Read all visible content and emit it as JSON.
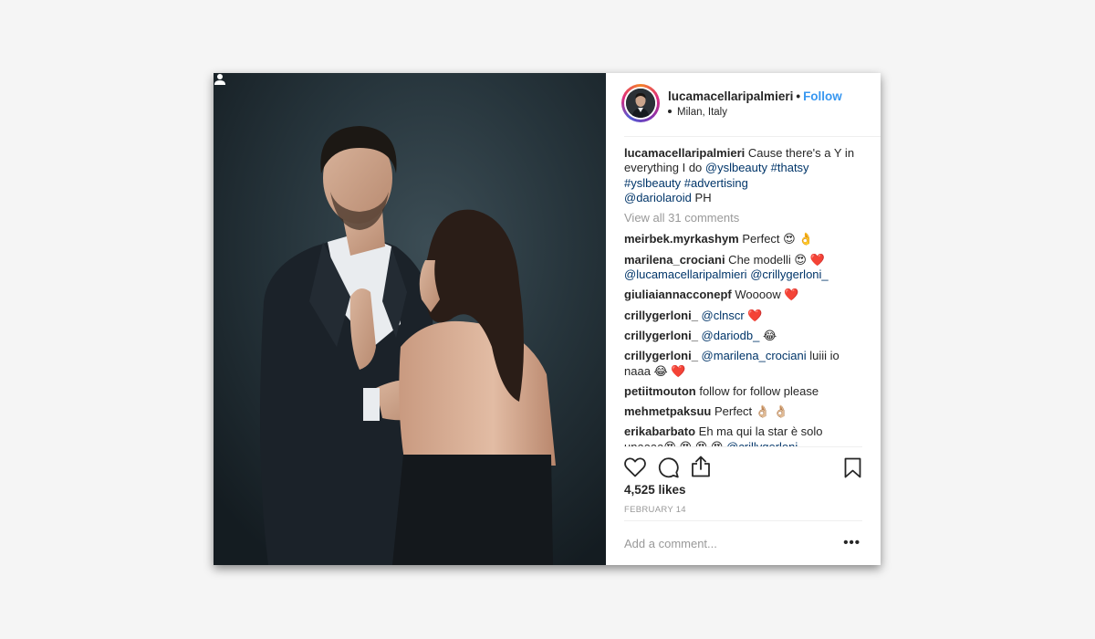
{
  "post": {
    "username": "lucamacellaripalmieri",
    "separator": "•",
    "follow_label": "Follow",
    "location": "Milan, Italy",
    "caption": {
      "username": "lucamacellaripalmieri",
      "text_1": " Cause there's a Y in everything I do ",
      "mention_1": "@yslbeauty",
      "space": " ",
      "tag_1": "#thatsy",
      "tag_2": "#yslbeauty",
      "tag_3": "#advertising",
      "mention_2": "@dariolaroid",
      "text_2": " PH"
    },
    "view_all": "View all 31 comments",
    "comments": [
      {
        "user": "meirbek.myrkashym",
        "text": " Perfect 😍 👌"
      },
      {
        "user": "marilena_crociani",
        "text": " Che modelli 😍 ❤️",
        "mention": "@lucamacellaripalmieri",
        "mention2": "@crillygerloni_"
      },
      {
        "user": "giuliaiannacconepf",
        "text": " Woooow ❤️"
      },
      {
        "user": "crillygerloni_",
        "mention": "@clnscr",
        "text": " ❤️"
      },
      {
        "user": "crillygerloni_",
        "mention": "@dariodb_",
        "text": " 😂"
      },
      {
        "user": "crillygerloni_",
        "mention": "@marilena_crociani",
        "text": " luiii io naaa 😂 ❤️"
      },
      {
        "user": "petiitmouton",
        "text": " follow for follow please"
      },
      {
        "user": "mehmetpaksuu",
        "text": " Perfect 👌🏼 👌🏼"
      },
      {
        "user": "erikabarbato",
        "text": " Eh ma qui la star è solo unaaaa😍 😍 😍 😍 ",
        "mention": "@crillygerloni"
      }
    ],
    "likes": "4,525 likes",
    "date": "FEBRUARY 14",
    "add_comment_placeholder": "Add a comment...",
    "more_label": "•••"
  },
  "icons": {
    "like": "heart-icon",
    "comment": "comment-icon",
    "share": "share-icon",
    "save": "bookmark-icon",
    "tagged": "person-tag-icon"
  },
  "colors": {
    "link": "#3897f0",
    "mention": "#003569",
    "muted": "#999999",
    "text": "#262626"
  }
}
